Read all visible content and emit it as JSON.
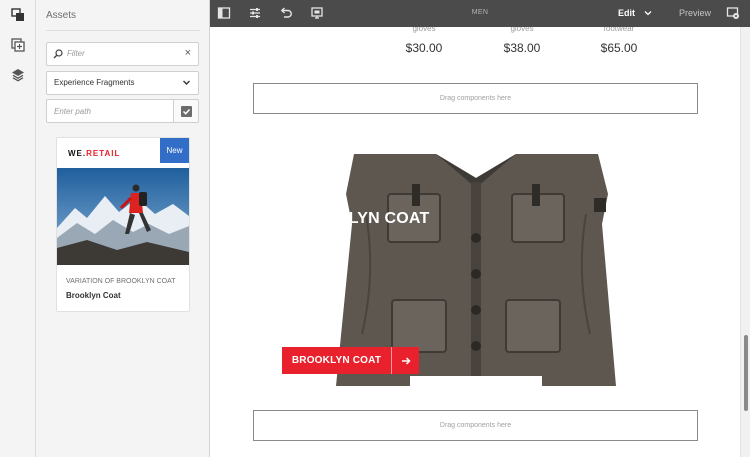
{
  "rail": {
    "icons": [
      "assets-icon",
      "components-icon",
      "layers-icon"
    ]
  },
  "panel": {
    "title": "Assets",
    "filter_placeholder": "Filter",
    "clear_symbol": "×",
    "asset_type": "Experience Fragments",
    "path_placeholder": "Enter path",
    "card": {
      "logo_prefix": "WE.",
      "logo_suffix": "RETAIL",
      "badge": "New",
      "subtitle": "VARIATION OF BROOKLYN COAT",
      "name": "Brooklyn Coat"
    }
  },
  "toolbar": {
    "page_title": "MEN",
    "mode": "Edit",
    "preview_label": "Preview"
  },
  "canvas": {
    "products": [
      {
        "caption": "gloves",
        "price": "$30.00"
      },
      {
        "caption": "gloves",
        "price": "$38.00"
      },
      {
        "caption": "footwear",
        "price": "$65.00"
      }
    ],
    "dropzone_top": "Drag components here",
    "dropzone_bottom": "Drag components here",
    "hero_title": "KLYN COAT",
    "cta_label": "BROOKLYN COAT"
  },
  "colors": {
    "accent_blue": "#326ec8",
    "brand_red": "#e8212c",
    "toolbar_bg": "#4b4b4b",
    "panel_bg": "#f4f4f4"
  }
}
